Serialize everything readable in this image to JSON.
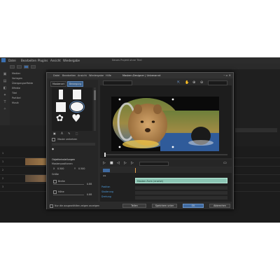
{
  "app": {
    "title": "Neues Projekt ohne Titel",
    "menu": [
      "Datei",
      "Bearbeiten",
      "Plugins",
      "Ansicht",
      "Wiedergabe"
    ],
    "library_items": [
      "Medien",
      "Vorlagen",
      "Übergangseffekte",
      "Effekte",
      "Titel",
      "Partikel",
      "Musik"
    ],
    "track_labels": [
      "1",
      "1",
      "2",
      "2",
      "3"
    ]
  },
  "dialog": {
    "menu": [
      "Datei",
      "Bearbeiten",
      "Ansicht",
      "Wiedergabe",
      "Hilfe"
    ],
    "title": "Masken-Designer | Unbenannt",
    "tabs": [
      "Maskenart",
      "Bewegung"
    ],
    "mask_option": "Maske umkehren",
    "settings_header": "Objekteinstellungen",
    "settings_sub": "Maskenpositionen",
    "field_x": "X",
    "field_y": "Y",
    "x_value": "0.500",
    "y_value": "0.500",
    "size_label": "Größe",
    "width_label": "Breite",
    "width_value": "0.88",
    "height_label": "Höhe",
    "height_value": "0.88",
    "keyframe_rows": [
      "Position",
      "Skalierung",
      "Drehung"
    ],
    "keyframe_bar_label": "Masken-Form (ersetzt)",
    "footer_checkbox": "Nur die ausgewählten zeigen anzeigen",
    "buttons": {
      "share": "Teilen",
      "save_as": "Speichern unter",
      "ok": "OK",
      "cancel": "Abbrechen"
    }
  },
  "icons": [
    "search-icon",
    "close-icon",
    "minimize-icon",
    "maximize-icon",
    "play-icon",
    "stop-icon",
    "prev-frame-icon",
    "next-frame-icon",
    "fullscreen-icon",
    "hand-icon",
    "zoom-in-icon",
    "zoom-out-icon"
  ],
  "colors": {
    "accent": "#3f6aa0",
    "keyframe_bar": "#8cc5b4",
    "background": "#232323"
  }
}
